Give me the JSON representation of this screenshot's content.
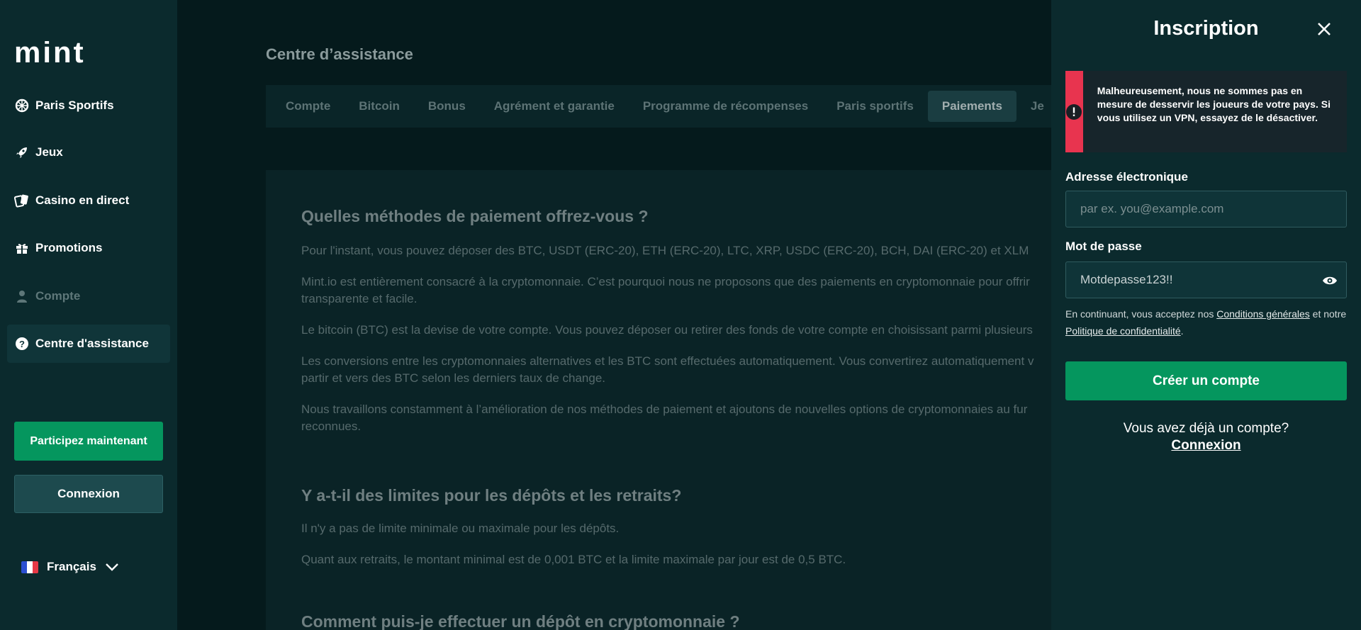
{
  "sidebar": {
    "logo_text": "mint",
    "items": [
      {
        "label": "Paris Sportifs",
        "icon": "sports-ball-icon"
      },
      {
        "label": "Jeux",
        "icon": "rocket-icon"
      },
      {
        "label": "Casino en direct",
        "icon": "cards-icon"
      },
      {
        "label": "Promotions",
        "icon": "gift-icon"
      },
      {
        "label": "Compte",
        "icon": "user-icon"
      },
      {
        "label": "Centre d'assistance",
        "icon": "help-icon"
      }
    ],
    "join_label": "Participez maintenant",
    "login_label": "Connexion",
    "language": "Français"
  },
  "main": {
    "title": "Centre d’assistance",
    "tabs": [
      "Compte",
      "Bitcoin",
      "Bonus",
      "Agrément et garantie",
      "Programme de récompenses",
      "Paris sportifs",
      "Paiements",
      "Je"
    ],
    "active_tab": "Paiements",
    "faq": [
      {
        "question": "Quelles méthodes de paiement offrez-vous ?",
        "paragraphs": [
          "Pour l'instant, vous pouvez déposer des BTC, USDT (ERC-20), ETH (ERC-20), LTC, XRP, USDC (ERC-20), BCH, DAI (ERC-20) et XLM",
          "Mint.io est entièrement consacré à la cryptomonnaie. C’est pourquoi nous ne proposons que des paiements en cryptomonnaie pour offrir",
          "transparente et facile.",
          "Le bitcoin (BTC) est la devise de votre compte. Vous pouvez déposer ou retirer des fonds de votre compte en choisissant parmi plusieurs",
          "Les conversions entre les cryptomonnaies alternatives et les BTC sont effectuées automatiquement. Vous convertirez automatiquement v",
          "partir et vers des BTC selon les derniers taux de change.",
          "Nous travaillons constamment à l’amélioration de nos méthodes de paiement et ajoutons de nouvelles options de cryptomonnaies au fur",
          "reconnues."
        ]
      },
      {
        "question": "Y a-t-il des limites pour les dépôts et les retraits?",
        "paragraphs": [
          "Il n'y a pas de limite minimale ou maximale pour les dépôts.",
          "Quant aux retraits, le montant minimal est de 0,001 BTC et la limite maximale par jour est de 0,5 BTC."
        ]
      },
      {
        "question": "Comment puis-je effectuer un dépôt en cryptomonnaie ?",
        "paragraphs": []
      }
    ]
  },
  "panel": {
    "title": "Inscription",
    "alert_text": "Malheureusement, nous ne sommes pas en mesure de desservir les joueurs de votre pays. Si vous utilisez un VPN, essayez de le désactiver.",
    "email_label": "Adresse électronique",
    "email_placeholder": "par ex. you@example.com",
    "password_label": "Mot de passe",
    "password_value": "Motdepasse123!!",
    "terms_prefix": "En continuant, vous acceptez nos",
    "terms_link": "Conditions générales",
    "terms_mid": "et notre",
    "privacy_link": "Politique de confidentialité",
    "create_label": "Créer un compte",
    "have_account": "Vous avez déjà un compte?",
    "login_link": "Connexion"
  },
  "colors": {
    "accent_green": "#05965e",
    "alert_red": "#e8344f",
    "sidebar_bg": "#0b2a2d"
  }
}
